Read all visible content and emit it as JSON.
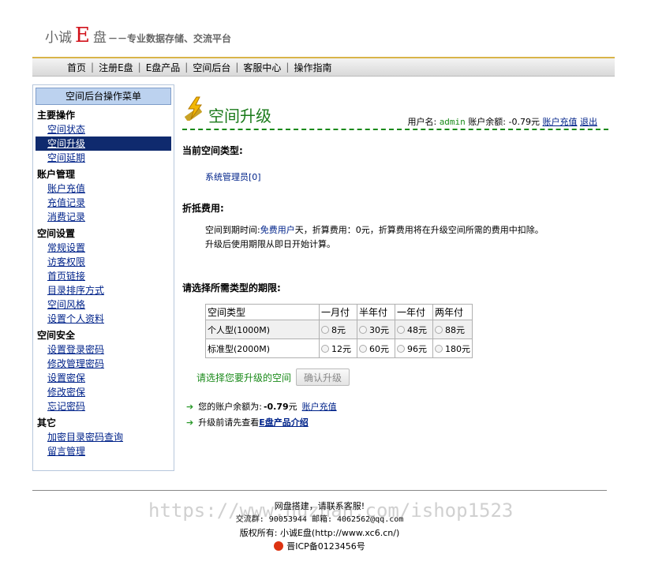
{
  "logo": {
    "part1": "小诚",
    "part2": "E",
    "part3": "盘",
    "slogan": "－－专业数据存储、交流平台"
  },
  "topnav": [
    "首页",
    "注册E盘",
    "E盘产品",
    "空间后台",
    "客服中心",
    "操作指南"
  ],
  "sidebar": {
    "title": "空间后台操作菜单",
    "groups": [
      {
        "title": "主要操作",
        "items": [
          "空间状态",
          "空间升级",
          "空间延期"
        ]
      },
      {
        "title": "账户管理",
        "items": [
          "账户充值",
          "充值记录",
          "消费记录"
        ]
      },
      {
        "title": "空间设置",
        "items": [
          "常规设置",
          "访客权限",
          "首页链接",
          "目录排序方式",
          "空间风格",
          "设置个人资料"
        ]
      },
      {
        "title": "空间安全",
        "items": [
          "设置登录密码",
          "修改管理密码",
          "设置密保",
          "修改密保",
          "忘记密码"
        ]
      },
      {
        "title": "其它",
        "items": [
          "加密目录密码查询",
          "留言管理"
        ]
      }
    ],
    "active": "空间升级"
  },
  "page": {
    "title": "空间升级",
    "user_label": "用户名:",
    "username": "admin",
    "balance_label": "账户余额:",
    "balance": "-0.79元",
    "recharge": "账户充值",
    "logout": "退出"
  },
  "current_type": {
    "heading": "当前空间类型:",
    "value": "系统管理员[0]"
  },
  "discount": {
    "heading": "折抵费用:",
    "line1_a": "空间到期时间:",
    "line1_b": "免费用户",
    "line1_c": "天，折算费用：0元，折算费用将在升级空间所需的费用中扣除。",
    "line2": "升级后使用期限从即日开始计算。"
  },
  "plans": {
    "heading": "请选择所需类型的期限:",
    "headers": [
      "空间类型",
      "一月付",
      "半年付",
      "一年付",
      "两年付"
    ],
    "rows": [
      {
        "type": "个人型(1000M)",
        "prices": [
          "8元",
          "30元",
          "48元",
          "88元"
        ]
      },
      {
        "type": "标准型(2000M)",
        "prices": [
          "12元",
          "60元",
          "96元",
          "180元"
        ]
      }
    ]
  },
  "confirm": {
    "hint": "请选择您要升级的空间",
    "button": "确认升级"
  },
  "notes": {
    "balance_prefix": "您的账户余额为:",
    "balance_value": "-0.79",
    "balance_unit": "元",
    "recharge": "账户充值",
    "intro_prefix": "升级前请先查看",
    "intro_link": "E盘产品介绍"
  },
  "footer": {
    "line1": "网盘搭建，请联系客服!",
    "line2": "交流群: 90053944 邮箱: 4062562@qq.com",
    "line3": "版权所有: 小诚E盘(http://www.xc6.cn/)",
    "icp": "晋ICP备0123456号",
    "watermark": "https://www.huzhan.com/ishop1523"
  },
  "colors": {
    "accent_green": "#1a8a1a",
    "link_blue": "#00238a",
    "active_menu": "#0f2a6e",
    "warning_red": "#d1121b"
  }
}
